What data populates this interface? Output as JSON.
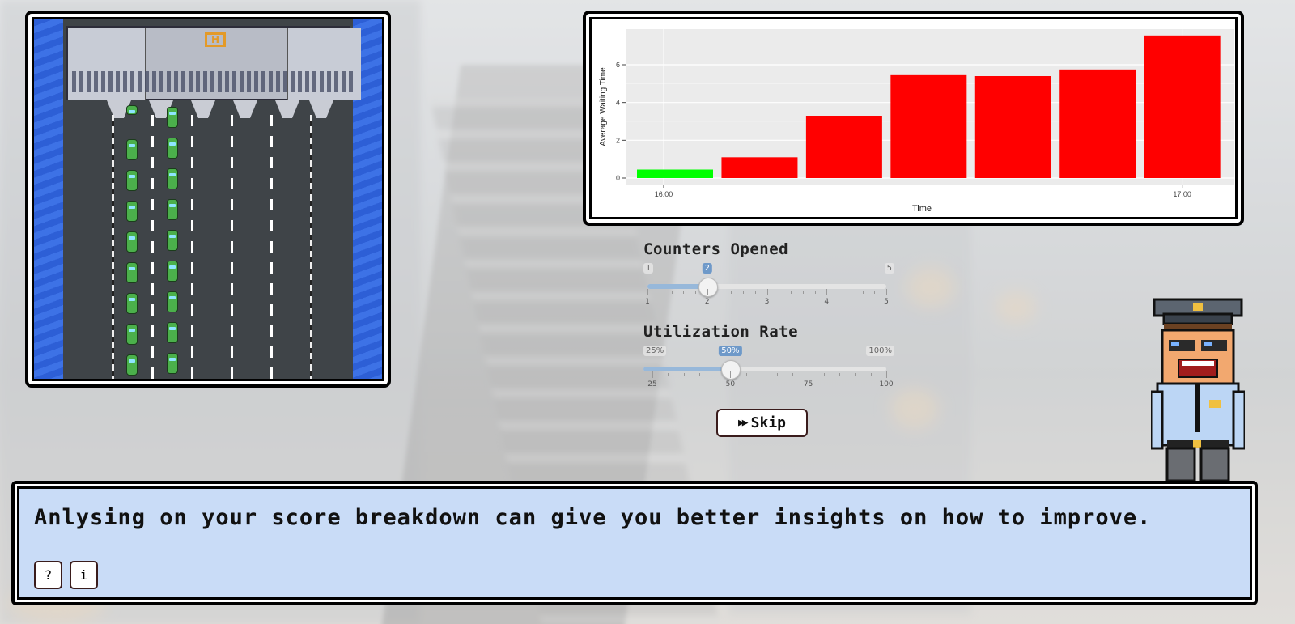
{
  "chart_data": {
    "type": "bar",
    "xlabel": "Time",
    "ylabel": "Average Waiting Time",
    "x_ticks": [
      "16:00",
      "17:00"
    ],
    "y_ticks": [
      0,
      2,
      4,
      6
    ],
    "ylim": [
      0,
      7.8
    ],
    "grid": true,
    "values": [
      0.45,
      1.1,
      3.3,
      5.45,
      5.4,
      5.75,
      7.55
    ],
    "colors": [
      "#00ff00",
      "#ff0000",
      "#ff0000",
      "#ff0000",
      "#ff0000",
      "#ff0000",
      "#ff0000"
    ],
    "background": "#ebebeb"
  },
  "sliders": {
    "counters": {
      "label": "Counters Opened",
      "min_label": "1",
      "max_label": "5",
      "value_label": "2",
      "value": 2,
      "min": 1,
      "max": 5,
      "ticks": [
        "1",
        "2",
        "3",
        "4",
        "5"
      ]
    },
    "utilization": {
      "label": "Utilization Rate",
      "min_label": "25%",
      "max_label": "100%",
      "value_label": "50%",
      "value": 50,
      "min": 25,
      "max": 100,
      "ticks": [
        "25",
        "50",
        "75",
        "100"
      ]
    }
  },
  "skip_button": {
    "label": "Skip",
    "icon": "fast-forward-icon"
  },
  "dialog": {
    "text": "Anlysing on your score breakdown can give you better insights on how to improve.",
    "help_label": "?",
    "info_label": "i"
  },
  "game": {
    "booth_sign": "H"
  }
}
